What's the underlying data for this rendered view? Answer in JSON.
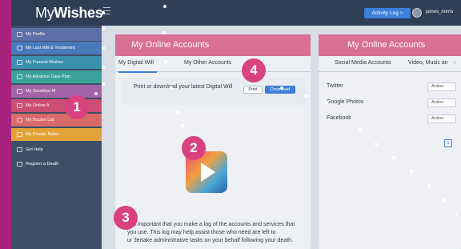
{
  "header": {
    "logo_light": "My",
    "logo_bold": "Wishes",
    "activity_log": "Activity Log  >",
    "username": "james_norris"
  },
  "sidebar": {
    "items": [
      {
        "label": "My Profile",
        "color": "#5f6fa8"
      },
      {
        "label": "My Last Will & Testament",
        "color": "#4a78b8"
      },
      {
        "label": "My Funeral Wishes",
        "color": "#3c8fae"
      },
      {
        "label": "My Advance Care Plan",
        "color": "#3aa29a"
      },
      {
        "label": "My Goodbye M",
        "color": "#a264a7"
      },
      {
        "label": "My Online A",
        "color": "#cd4d75"
      },
      {
        "label": "My Bucket List",
        "color": "#d96a6a"
      },
      {
        "label": "My Private Notes",
        "color": "#e2a23a"
      },
      {
        "label": "Get Help",
        "color": ""
      },
      {
        "label": "Register a Death",
        "color": ""
      }
    ]
  },
  "left_card": {
    "title": "My Online Accounts",
    "tabs": [
      "My Digital Will",
      "My Other Accounts"
    ],
    "info_text": "Print or download your latest Digital Will",
    "print_label": "Print",
    "download_label": "Download",
    "body_text": "It is important that you make a log of the accounts and services that you use. This log may help assist those who need are left to undertake administrative tasks on your behalf following your death."
  },
  "right_card": {
    "title": "My Online Accounts",
    "tabs": [
      "Social Media Accounts",
      "Video, Music an"
    ],
    "accounts": [
      {
        "name": "Twitter",
        "action": "Action"
      },
      {
        "name": "Google Photos",
        "action": "Action"
      },
      {
        "name": "Facebook",
        "action": "Action"
      }
    ],
    "page": "1"
  },
  "badges": [
    "1",
    "2",
    "3",
    "4"
  ],
  "colors": {
    "brand_magenta": "#a8237e",
    "header": "#2d3e55",
    "accent": "#3d7fd9",
    "card_head": "#d96f93"
  }
}
